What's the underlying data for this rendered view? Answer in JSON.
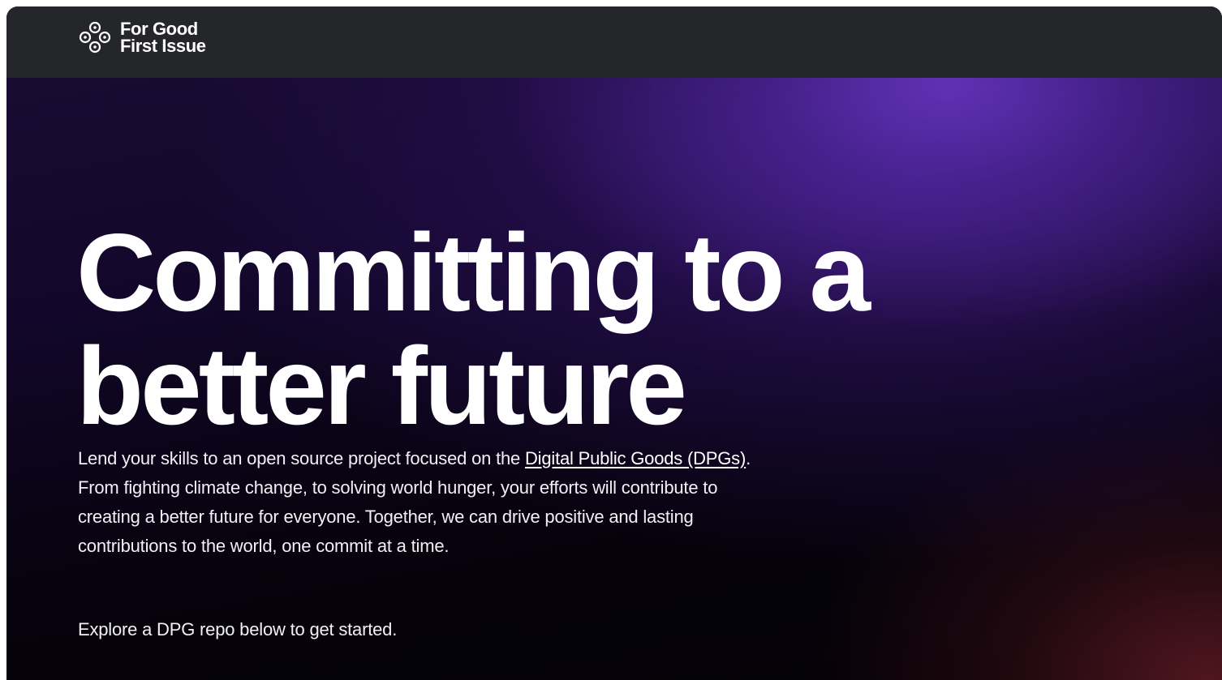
{
  "navbar": {
    "logo_icon": "four-circles-logo-icon",
    "logo_line1": "For Good",
    "logo_line2": "First Issue"
  },
  "hero": {
    "title_line1": "Committing to a",
    "title_line2": "better future",
    "description_before_link": "Lend your skills to an open source project focused on the ",
    "description_link": "Digital Public Goods (DPGs)",
    "description_after_link": ". From fighting climate change, to solving world hunger, your efforts will contribute to creating a better future for everyone. Together, we can drive positive and lasting contributions to the world, one commit at a time.",
    "cta_text": "Explore a DPG repo below to get started."
  },
  "colors": {
    "navbar_bg": "#24262a",
    "hero_purple": "#5a2fb0",
    "hero_dark": "#020104",
    "hero_red_glow": "#701e2a",
    "text": "#ffffff"
  }
}
